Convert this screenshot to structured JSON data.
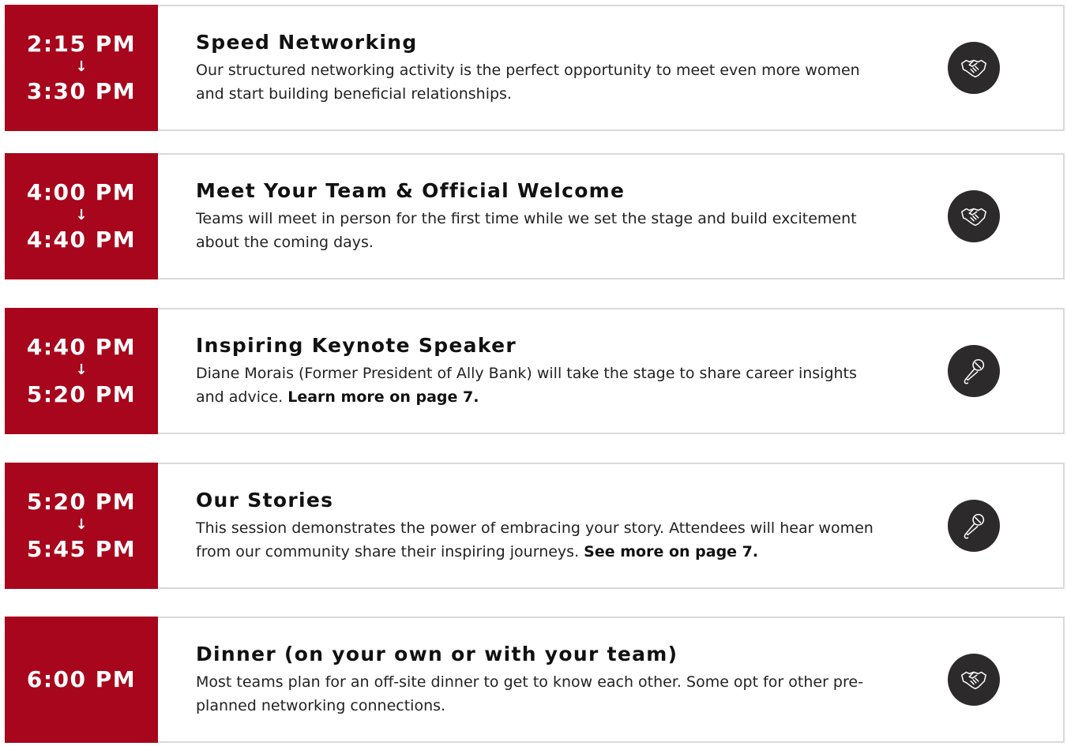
{
  "schedule": [
    {
      "time_start": "2:15 PM",
      "arrow": "↓",
      "time_end": "3:30 PM",
      "title": "Speed Networking",
      "description": "Our structured networking activity is the perfect opportunity to meet even more women and start building beneficial relationships.",
      "link": "",
      "icon": "handshake-icon"
    },
    {
      "time_start": "4:00 PM",
      "arrow": "↓",
      "time_end": "4:40 PM",
      "title": "Meet Your Team & Official Welcome",
      "description": "Teams will meet in person for the first time while we set the stage and build excitement about the coming days.",
      "link": "",
      "icon": "handshake-icon"
    },
    {
      "time_start": "4:40 PM",
      "arrow": "↓",
      "time_end": "5:20 PM",
      "title": "Inspiring Keynote Speaker",
      "description": "Diane Morais (Former President of Ally Bank) will take the stage to share career insights and advice.",
      "link": "Learn more on page 7.",
      "icon": "microphone-icon"
    },
    {
      "time_start": "5:20 PM",
      "arrow": "↓",
      "time_end": "5:45 PM",
      "title": "Our Stories",
      "description": "This session demonstrates the power of embracing your story. Attendees will hear women from our community share their inspiring journeys.",
      "link": "See more on page 7.",
      "icon": "microphone-icon"
    },
    {
      "time_start": "6:00 PM",
      "arrow": "",
      "time_end": "",
      "title": "Dinner (on your own or with your team)",
      "description": "Most teams plan for an off-site dinner to get to know each other. Some opt for other pre-planned networking connections.",
      "link": "",
      "icon": "handshake-icon"
    }
  ],
  "colors": {
    "accent": "#a8061c",
    "icon_bg": "#2d2a2c",
    "border": "#d9d9d9"
  }
}
